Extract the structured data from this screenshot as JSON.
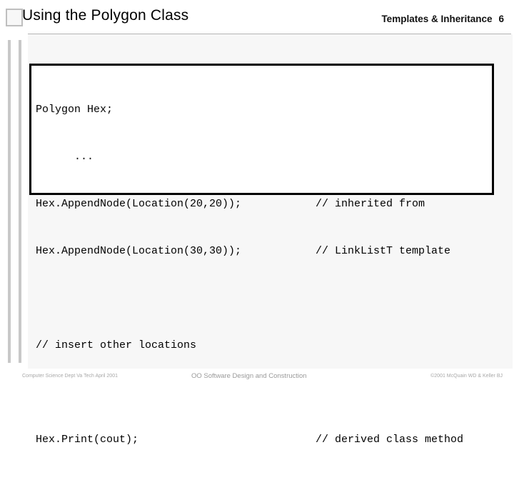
{
  "header": {
    "title": "Using the Polygon Class",
    "section": "Templates & Inheritance",
    "page_number": "6"
  },
  "code_block": {
    "lines": [
      {
        "left": "Polygon Hex;",
        "right": ""
      },
      {
        "left": "      ...",
        "right": ""
      },
      {
        "left": "Hex.AppendNode(Location(20,20));",
        "right": "// inherited from"
      },
      {
        "left": "Hex.AppendNode(Location(30,30));",
        "right": "// LinkListT template"
      },
      {
        "left": "",
        "right": ""
      },
      {
        "left": "// insert other locations",
        "right": ""
      },
      {
        "left": "",
        "right": ""
      },
      {
        "left": "Hex.Print(cout);",
        "right": "// derived class method"
      }
    ]
  },
  "footer": {
    "left": "Computer Science Dept Va Tech April 2001",
    "center": "OO Software Design and Construction",
    "right": "©2001 McQuain WD & Keller BJ"
  },
  "colors": {
    "panel_background": "#f7f7f7",
    "rule": "#b4b4b4",
    "decoration": "#c8c8c8",
    "code_border": "#000000",
    "footer_text": "#a8a8a8"
  }
}
